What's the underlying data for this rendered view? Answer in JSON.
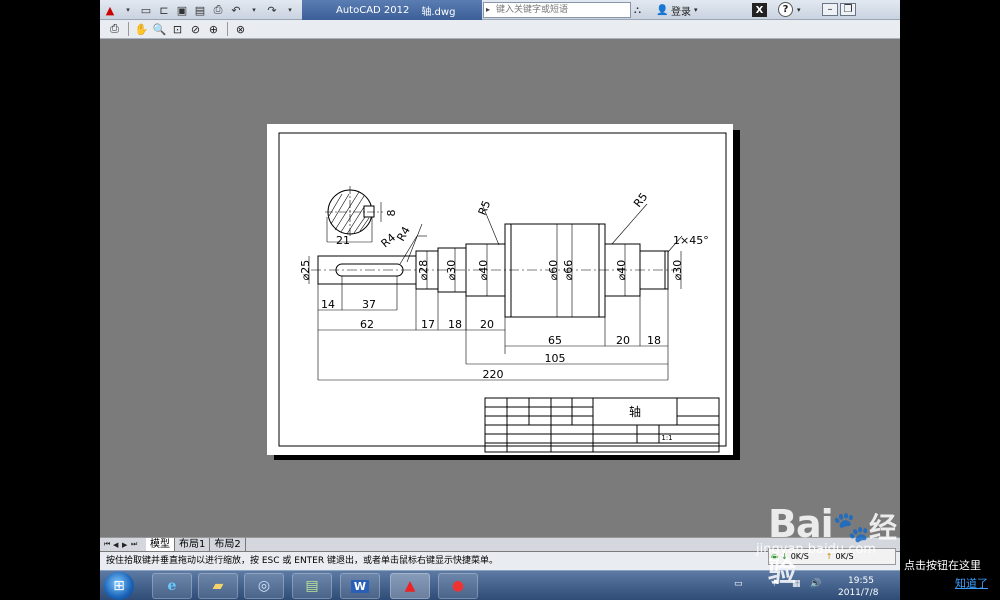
{
  "window": {
    "title": "AutoCAD 2012",
    "file": "轴.dwg",
    "search_placeholder": "键入关键字或短语",
    "login": "登录"
  },
  "drawing": {
    "dimensions": {
      "d25": "⌀25",
      "d28": "⌀28",
      "d30": "⌀30",
      "d40a": "⌀40",
      "d60": "⌀60",
      "d66": "⌀66",
      "d40b": "⌀40",
      "d30b": "⌀30",
      "l14": "14",
      "l37": "37",
      "l62": "62",
      "l17": "17",
      "l18": "18",
      "l20": "20",
      "l65": "65",
      "l20b": "20",
      "l18b": "18",
      "l105": "105",
      "l220": "220",
      "r4a": "R4",
      "r4b": "R4",
      "r5a": "R5",
      "r5b": "R5",
      "chamfer": "1×45°",
      "key8": "8",
      "key21": "21"
    },
    "title_block": {
      "part_name": "轴",
      "scale_value": "1:1"
    }
  },
  "layout_tabs": [
    "模型",
    "布局1",
    "布局2"
  ],
  "status_prompt": "按住拾取键并垂直拖动以进行缩放，按 ESC 或 ENTER 键退出，或者单击鼠标右键显示快捷菜单。",
  "netmon": {
    "down": "0K/S",
    "up": "0K/S"
  },
  "clock": {
    "time": "19:55",
    "date": "2011/7/8"
  },
  "watermark": {
    "brand": "Bai",
    "brand2": "经验",
    "url": "jingyan.baidu.com"
  },
  "notification": {
    "text": "点击按钮在这里",
    "link": "知道了"
  }
}
